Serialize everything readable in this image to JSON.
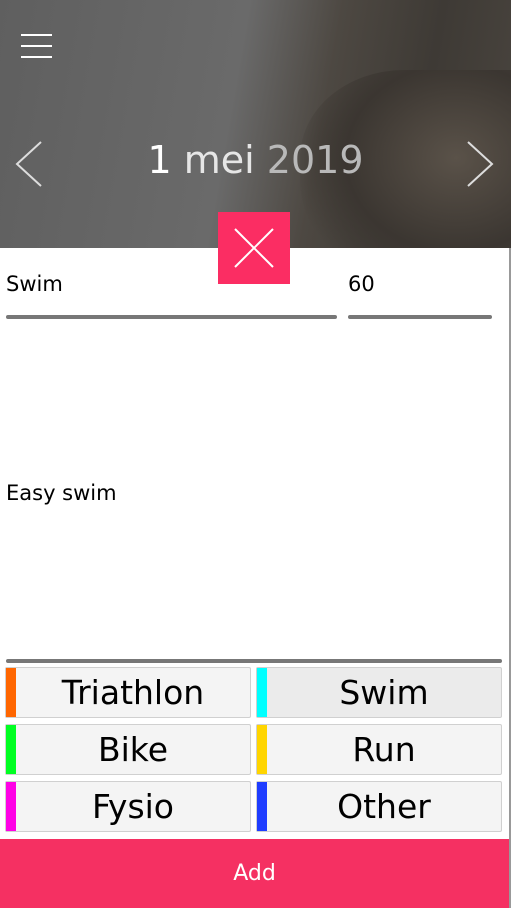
{
  "header": {
    "day": "1",
    "month": "mei",
    "year": "2019"
  },
  "form": {
    "title_value": "Swim",
    "duration_value": "60",
    "description_value": "Easy swim"
  },
  "categories": [
    {
      "label": "Triathlon",
      "color": "#ff6600",
      "selected": false
    },
    {
      "label": "Swim",
      "color": "#00ffff",
      "selected": true
    },
    {
      "label": "Bike",
      "color": "#00ff22",
      "selected": false
    },
    {
      "label": "Run",
      "color": "#ffd500",
      "selected": false
    },
    {
      "label": "Fysio",
      "color": "#ff00e6",
      "selected": false
    },
    {
      "label": "Other",
      "color": "#1f3dff",
      "selected": false
    }
  ],
  "actions": {
    "add_label": "Add"
  }
}
